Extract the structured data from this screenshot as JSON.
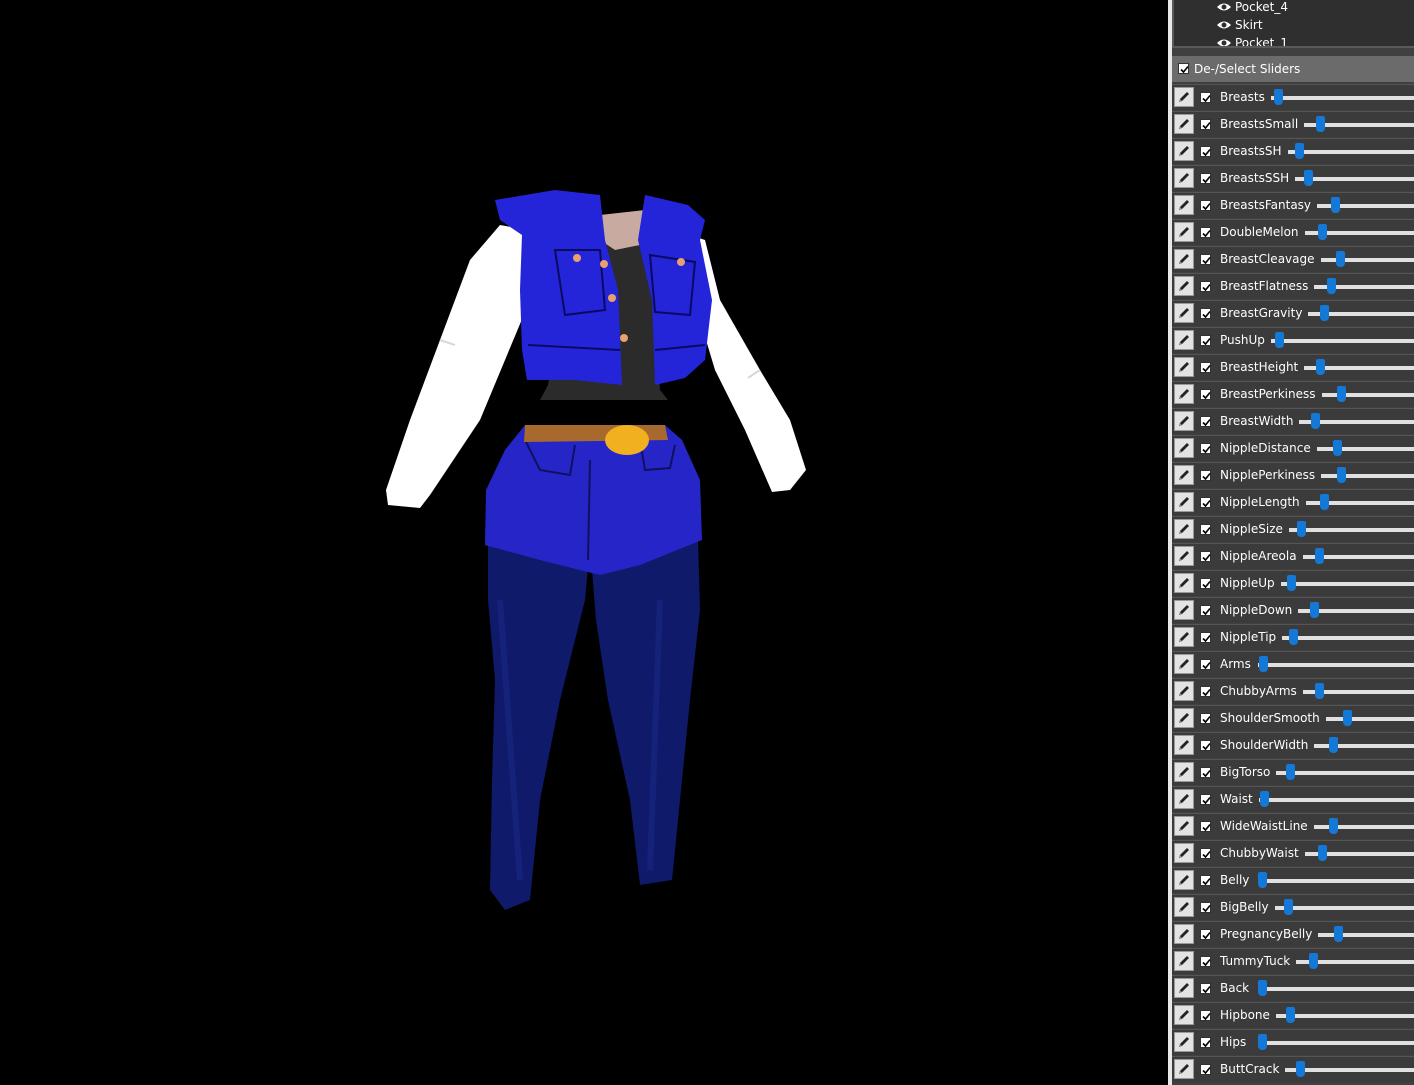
{
  "viewport": {
    "background": "#000000",
    "garment_colors": {
      "vest": "#2424d8",
      "skirt": "#2626c8",
      "leggings": "#0f1a6a",
      "sleeves": "#ffffff",
      "top": "#2b2b2b",
      "belt": "#a8692e",
      "buckle": "#f0b020"
    }
  },
  "shape_tree": {
    "items": [
      {
        "icon": "eye-icon",
        "label": "Pocket_4"
      },
      {
        "icon": "eye-icon",
        "label": "Skirt"
      },
      {
        "icon": "eye-icon",
        "label": "Pocket_1"
      }
    ]
  },
  "deselect": {
    "label": "De-/Select Sliders",
    "checked": true
  },
  "sliders": [
    {
      "label": "Breasts",
      "value": 0.02
    },
    {
      "label": "BreastsSmall",
      "value": 0.12
    },
    {
      "label": "BreastsSH",
      "value": 0.06
    },
    {
      "label": "BreastsSSH",
      "value": 0.08
    },
    {
      "label": "BreastsFantasy",
      "value": 0.16
    },
    {
      "label": "DoubleMelon",
      "value": 0.13
    },
    {
      "label": "BreastCleavage",
      "value": 0.18
    },
    {
      "label": "BreastFlatness",
      "value": 0.14
    },
    {
      "label": "BreastGravity",
      "value": 0.12
    },
    {
      "label": "PushUp",
      "value": 0.03
    },
    {
      "label": "BreastHeight",
      "value": 0.12
    },
    {
      "label": "BreastPerkiness",
      "value": 0.18
    },
    {
      "label": "BreastWidth",
      "value": 0.11
    },
    {
      "label": "NippleDistance",
      "value": 0.18
    },
    {
      "label": "NipplePerkiness",
      "value": 0.19
    },
    {
      "label": "NippleLength",
      "value": 0.14
    },
    {
      "label": "NippleSize",
      "value": 0.07
    },
    {
      "label": "NippleAreola",
      "value": 0.12
    },
    {
      "label": "NippleUp",
      "value": 0.05
    },
    {
      "label": "NippleDown",
      "value": 0.11
    },
    {
      "label": "NippleTip",
      "value": 0.06
    },
    {
      "label": "Arms",
      "value": 0.01
    },
    {
      "label": "ChubbyArms",
      "value": 0.12
    },
    {
      "label": "ShoulderSmooth",
      "value": 0.21
    },
    {
      "label": "ShoulderWidth",
      "value": 0.17
    },
    {
      "label": "BigTorso",
      "value": 0.08
    },
    {
      "label": "Waist",
      "value": 0.01
    },
    {
      "label": "WideWaistLine",
      "value": 0.16
    },
    {
      "label": "ChubbyWaist",
      "value": 0.13
    },
    {
      "label": "Belly",
      "value": 0.0
    },
    {
      "label": "BigBelly",
      "value": 0.07
    },
    {
      "label": "PregnancyBelly",
      "value": 0.18
    },
    {
      "label": "TummyTuck",
      "value": 0.12
    },
    {
      "label": "Back",
      "value": 0.0
    },
    {
      "label": "Hipbone",
      "value": 0.08
    },
    {
      "label": "Hips",
      "value": 0.0
    },
    {
      "label": "ButtCrack",
      "value": 0.09
    }
  ]
}
